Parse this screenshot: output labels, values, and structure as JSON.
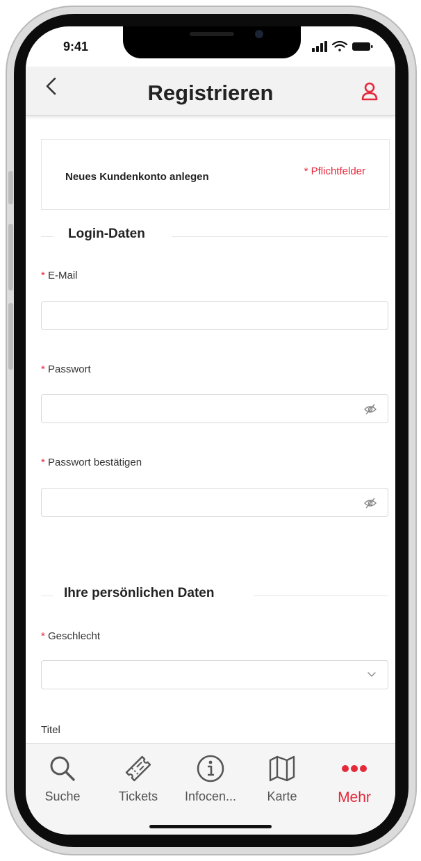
{
  "status_bar": {
    "time": "9:41"
  },
  "header": {
    "back_label": "<",
    "title": "Registrieren"
  },
  "intro_card": {
    "label": "Neues Kundenkonto anlegen",
    "required_note": "* Pflichtfelder"
  },
  "sections": {
    "login": "Login-Daten",
    "personal": "Ihre persönlichen Daten"
  },
  "fields": {
    "email": {
      "required_mark": "*",
      "label": "E-Mail",
      "value": ""
    },
    "password": {
      "required_mark": "*",
      "label": "Passwort",
      "value": ""
    },
    "password_confirm": {
      "required_mark": "*",
      "label": "Passwort bestätigen",
      "value": ""
    },
    "gender": {
      "required_mark": "*",
      "label": "Geschlecht",
      "value": ""
    },
    "title": {
      "label": "Titel"
    }
  },
  "tabbar": {
    "items": [
      {
        "label": "Suche",
        "icon": "search-icon"
      },
      {
        "label": "Tickets",
        "icon": "ticket-icon"
      },
      {
        "label": "Infocen...",
        "icon": "info-icon"
      },
      {
        "label": "Karte",
        "icon": "map-icon"
      },
      {
        "label": "Mehr",
        "icon": "more-dots-icon",
        "active": true
      }
    ]
  },
  "colors": {
    "accent": "#e5283a",
    "header_bg": "#f2f2f2",
    "tabbar_bg": "#f5f5f5"
  }
}
